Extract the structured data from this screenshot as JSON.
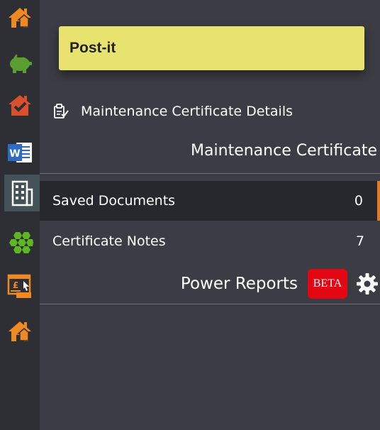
{
  "sidebar": {
    "icons": [
      {
        "name": "home-icon",
        "color": "#ef8a22"
      },
      {
        "name": "piggy-bank-icon",
        "color": "#5a9e2f"
      },
      {
        "name": "home-check-icon",
        "color": "#d9502c"
      },
      {
        "name": "word-document-icon",
        "color": "#2b6cc4"
      },
      {
        "name": "building-icon",
        "color": "#ffffff"
      },
      {
        "name": "hexagons-icon",
        "color": "#5fb623"
      },
      {
        "name": "invoice-icon",
        "color": "#ef8a22"
      },
      {
        "name": "home-icon",
        "color": "#ef8a22"
      }
    ]
  },
  "postit": {
    "label": "Post-it"
  },
  "details": {
    "label": "Maintenance Certificate Details",
    "icon": "clipboard-check-icon"
  },
  "section": {
    "title": "Maintenance Certificate"
  },
  "rows": [
    {
      "label": "Saved Documents",
      "count": "0",
      "selected": true
    },
    {
      "label": "Certificate Notes",
      "count": "7",
      "selected": false
    }
  ],
  "power_reports": {
    "title": "Power Reports",
    "badge": "BETA",
    "settings_icon": "gear-icon"
  },
  "colors": {
    "accent": "#e07b22",
    "postit": "#e8e36f",
    "beta": "#e30613"
  }
}
